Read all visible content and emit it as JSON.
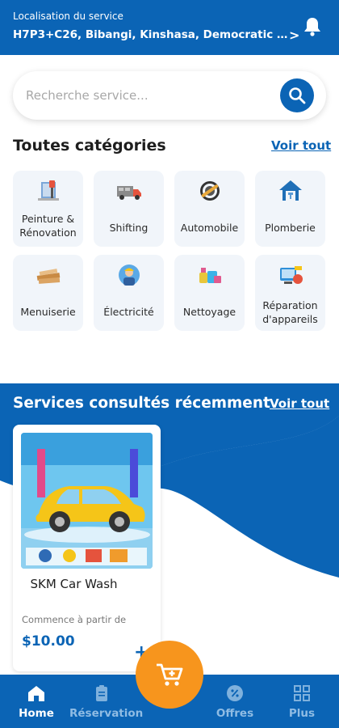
{
  "header": {
    "location_label": "Localisation du service",
    "location_value": "H7P3+C26, Bibangi, Kinshasa, Democratic Republic ...",
    "chevron": ">"
  },
  "search": {
    "placeholder": "Recherche service..."
  },
  "categories_section": {
    "title": "Toutes catégories",
    "see_all": "Voir tout",
    "items": [
      {
        "label": "Peinture & Rénovation",
        "icon": "paint-roller-icon"
      },
      {
        "label": "Shifting",
        "icon": "moving-truck-icon"
      },
      {
        "label": "Automobile",
        "icon": "gear-wrench-icon"
      },
      {
        "label": "Plomberie",
        "icon": "plumbing-house-icon"
      },
      {
        "label": "Menuiserie",
        "icon": "wood-planks-icon"
      },
      {
        "label": "Électricité",
        "icon": "electrician-icon"
      },
      {
        "label": "Nettoyage",
        "icon": "cleaning-supplies-icon"
      },
      {
        "label": "Réparation d'appareils",
        "icon": "appliance-repair-icon"
      }
    ]
  },
  "recent_section": {
    "title": "Services consultés récemment",
    "see_all": "Voir tout",
    "card": {
      "name": "SKM Car Wash",
      "price_label": "Commence à partir de",
      "price": "$10.00",
      "add": "+"
    }
  },
  "bottom_nav": {
    "items": [
      {
        "label": "Home",
        "icon": "home-icon",
        "active": true
      },
      {
        "label": "Réservation",
        "icon": "clipboard-icon",
        "active": false
      },
      {
        "label": "Offres",
        "icon": "discount-badge-icon",
        "active": false
      },
      {
        "label": "Plus",
        "icon": "grid-icon",
        "active": false
      }
    ],
    "fab_icon": "cart-add-icon"
  },
  "colors": {
    "primary": "#0b64b5",
    "accent": "#f7951d",
    "card_bg": "#f1f5fa"
  }
}
